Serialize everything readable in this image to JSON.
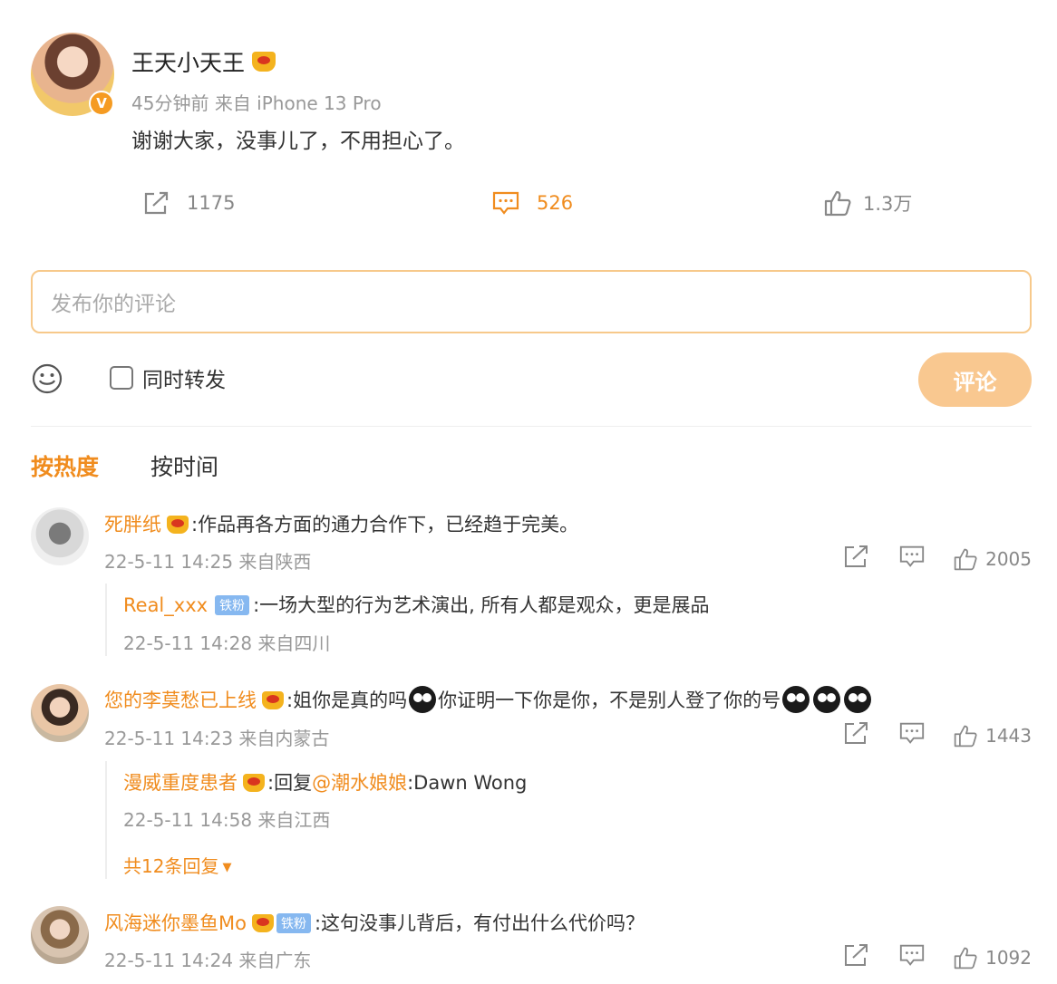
{
  "post": {
    "author": "王天小天王",
    "time": "45分钟前",
    "source": "来自 iPhone 13 Pro",
    "content": "谢谢大家，没事儿了，不用担心了。",
    "verified_mark": "V",
    "repost_count": "1175",
    "comment_count": "526",
    "like_count": "1.3万"
  },
  "composer": {
    "placeholder": "发布你的评论",
    "repost_label": "同时转发",
    "submit_label": "评论"
  },
  "sort": {
    "hot": "按热度",
    "time": "按时间"
  },
  "comments": [
    {
      "name": "死胖纸",
      "text": ":作品再各方面的通力合作下，已经趋于完美。",
      "time": "22-5-11 14:25 来自陕西",
      "likes": "2005",
      "reply": {
        "name": "Real_xxx",
        "badge": "铁粉",
        "text": ":一场大型的行为艺术演出, 所有人都是观众，更是展品",
        "time": "22-5-11 14:28 来自四川"
      }
    },
    {
      "name": "您的李莫愁已上线",
      "text_a": ":姐你是真的吗",
      "text_b": "你证明一下你是你，不是别人登了你的号",
      "time": "22-5-11 14:23 来自内蒙古",
      "likes": "1443",
      "reply": {
        "name": "漫威重度患者",
        "text_a": ":回复",
        "mention": "@潮水娘娘",
        "text_b": ":Dawn Wong",
        "time": "22-5-11 14:58 来自江西"
      },
      "more": "共12条回复"
    },
    {
      "name": "风海迷你墨鱼Mo",
      "badge": "铁粉",
      "text": ":这句没事儿背后，有付出什么代价吗？",
      "time": "22-5-11 14:24 来自广东",
      "likes": "1092"
    }
  ],
  "colors": {
    "accent": "#f08c1e",
    "button": "#f9c890",
    "muted": "#999999"
  },
  "icons": [
    "repost-icon",
    "comment-icon",
    "like-icon",
    "smile-icon",
    "crown-icon",
    "emoji-icon",
    "chevron-down-icon"
  ]
}
